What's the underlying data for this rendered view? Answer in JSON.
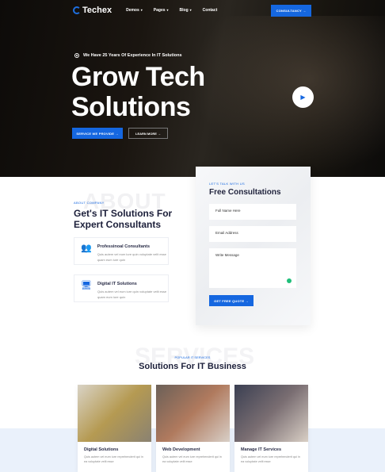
{
  "nav": {
    "brand": "Techex",
    "items": [
      {
        "label": "Demos",
        "dropdown": true
      },
      {
        "label": "Pages",
        "dropdown": true
      },
      {
        "label": "Blog",
        "dropdown": true
      },
      {
        "label": "Contact",
        "dropdown": false
      }
    ],
    "cta": "CONSULTANCY →"
  },
  "hero": {
    "experience": "We Have 25 Years Of Experience In IT Solutions",
    "title_line1": "Grow Tech",
    "title_line2": "Solutions",
    "primary_button": "SERVICE WE PROVIDE →",
    "secondary_button": "LEARN MORE →",
    "play_icon": "play-icon"
  },
  "about": {
    "ghost": "ABOUT",
    "subtitle": "ABOUT COMPANY",
    "title": "Get's IT Solutions For Expert Consultants",
    "features": [
      {
        "icon": "users-icon",
        "title": "Professinoal Consultants",
        "text": "Quis autem vel eum iure quin voluptate velit esse quam eum iure quin"
      },
      {
        "icon": "monitor-icon",
        "title": "Digital IT Solutions",
        "text": "Quis autem vel eum iure quin voluptate velit esse quam eum iure quin"
      }
    ]
  },
  "form": {
    "subtitle": "LET'S TALK WITH US",
    "title": "Free Consultations",
    "name_placeholder": "Full Name Here",
    "email_placeholder": "Email Address",
    "message_placeholder": "Write Message",
    "submit": "GET FREE QUOTE →"
  },
  "services": {
    "ghost": "SERVICES",
    "subtitle": "POPULAR IT SERVICES",
    "title": "Solutions For IT Business",
    "cards": [
      {
        "title": "Digital Solutions",
        "text": "Quis autem vel eum iure reprehenderit qui in ea voluptate velit esse"
      },
      {
        "title": "Web Development",
        "text": "Quis autem vel eum iure reprehenderit qui in ea voluptate velit esse"
      },
      {
        "title": "Manage IT Services",
        "text": "Quis autem vel eum iure reprehenderit qui in ea voluptate velit esse"
      }
    ]
  },
  "colors": {
    "accent": "#1567e0",
    "dark": "#1c1f3a"
  }
}
